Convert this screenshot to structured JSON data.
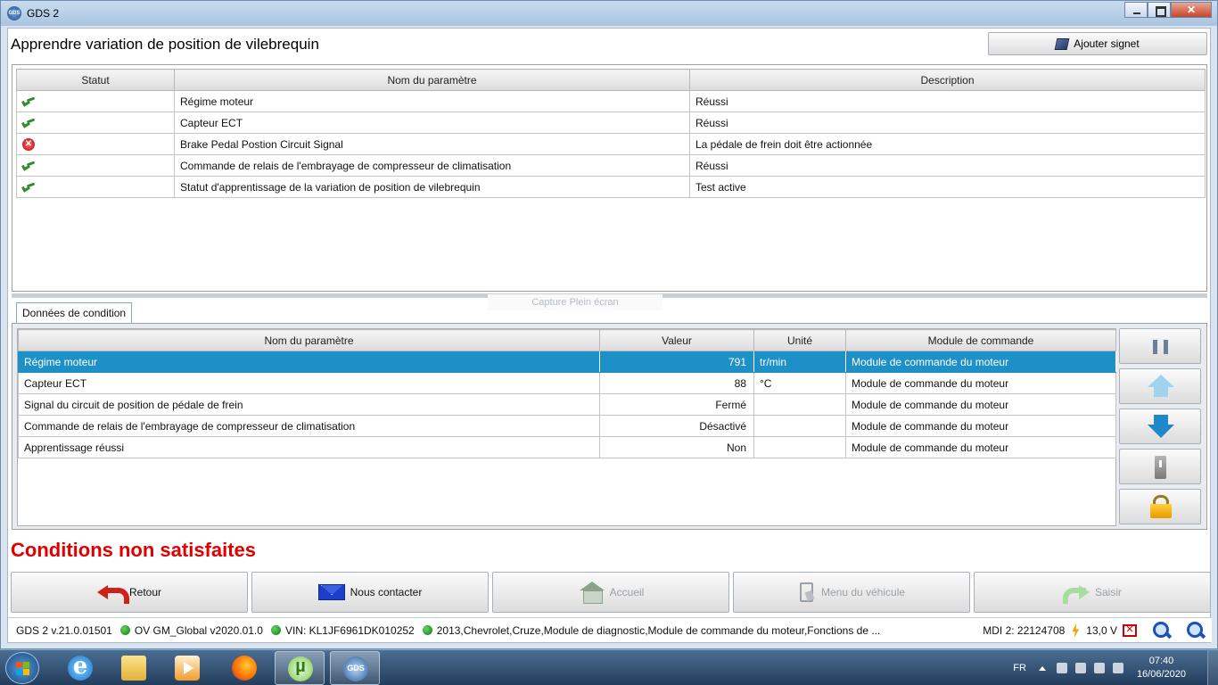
{
  "window": {
    "title": "GDS 2"
  },
  "header": {
    "page_title": "Apprendre variation de position de vilebrequin",
    "bookmark_label": "Ajouter signet"
  },
  "status_table": {
    "columns": [
      "Statut",
      "Nom du paramètre",
      "Description"
    ],
    "rows": [
      {
        "status": "check-icon",
        "name": "Régime moteur",
        "description": "Réussi"
      },
      {
        "status": "check-icon",
        "name": "Capteur ECT",
        "description": "Réussi"
      },
      {
        "status": "fail-icon",
        "name": "Brake Pedal Postion Circuit Signal",
        "description": "La pédale de frein doit être actionnée"
      },
      {
        "status": "check-icon",
        "name": "Commande de relais de l'embrayage de compresseur de climatisation",
        "description": "Réussi"
      },
      {
        "status": "check-icon",
        "name": "Statut d'apprentissage de la variation de position de vilebrequin",
        "description": "Test active"
      }
    ]
  },
  "capture_label": "Capture Plein écran",
  "tab": {
    "label": "Données de condition"
  },
  "data_table": {
    "columns": [
      "Nom du paramètre",
      "Valeur",
      "Unité",
      "Module de commande"
    ],
    "rows": [
      {
        "name": "Régime moteur",
        "value": "791",
        "unit": "tr/min",
        "module": "Module de commande du moteur",
        "selected": true
      },
      {
        "name": "Capteur ECT",
        "value": "88",
        "unit": "°C",
        "module": "Module de commande du moteur"
      },
      {
        "name": "Signal du circuit de position de pédale de frein",
        "value": "Fermé",
        "unit": "",
        "module": "Module de commande du moteur"
      },
      {
        "name": "Commande de relais de l'embrayage de compresseur de climatisation",
        "value": "Désactivé",
        "unit": "",
        "module": "Module de commande du moteur"
      },
      {
        "name": "Apprentissage réussi",
        "value": "Non",
        "unit": "",
        "module": "Module de commande du moteur"
      }
    ]
  },
  "side_buttons": [
    "pause-icon",
    "arrow-up-icon",
    "arrow-down-icon",
    "switch-icon",
    "lock-icon"
  ],
  "conditions_text": "Conditions non satisfaites",
  "nav": {
    "back": "Retour",
    "contact": "Nous contacter",
    "home": "Accueil",
    "vehicle_menu": "Menu du véhicule",
    "enter": "Saisir"
  },
  "statusbar": {
    "version": "GDS 2 v.21.0.01501",
    "ov": "OV GM_Global v2020.01.0",
    "vin": "VIN: KL1JF6961DK010252",
    "vehicle": "2013,Chevrolet,Cruze,Module de diagnostic,Module de commande du moteur,Fonctions de ...",
    "mdi": "MDI 2: 22124708",
    "voltage": "13,0 V"
  },
  "taskbar": {
    "lang": "FR",
    "time": "07:40",
    "date": "16/06/2020"
  },
  "colors": {
    "selected_row": "#1e90c8",
    "conditions_red": "#e00000",
    "status_dot_green": "#0e7d0e"
  }
}
